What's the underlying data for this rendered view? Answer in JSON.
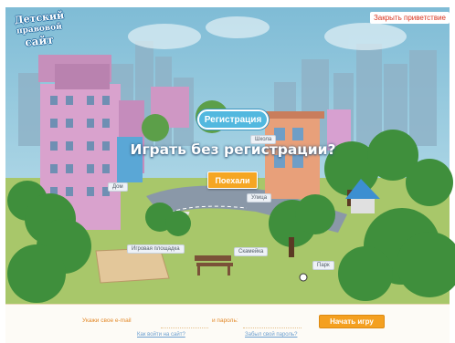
{
  "logo": {
    "line1": "Детский",
    "line2": "правовой",
    "line3": "сайт"
  },
  "header": {
    "close_greeting": "Закрыть приветствие"
  },
  "hero": {
    "register_label": "Регистрация",
    "title": "Играть без регистрации?",
    "go_label": "Поехали"
  },
  "signs": {
    "school": "Школа",
    "home": "Дом",
    "street": "Улица",
    "playground": "Игровая площадка",
    "bench": "Скамейка",
    "park": "Парк"
  },
  "login": {
    "name_label": "Укажи свое e-mail",
    "password_label": "и пароль:",
    "start_label": "Начать игру",
    "enter_link": "Как войти на сайт?",
    "forgot_link": "Забыл свой пароль?"
  },
  "colors": {
    "sky": "#a9d3e6",
    "accent_orange": "#f5a623",
    "register_blue": "#52b8df",
    "close_red": "#d8331e"
  }
}
